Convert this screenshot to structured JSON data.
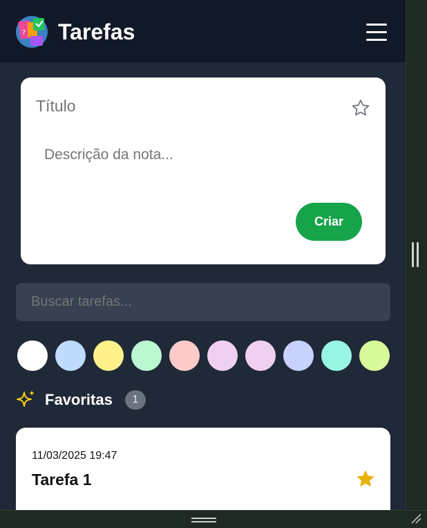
{
  "header": {
    "title": "Tarefas",
    "logo_icon": "sticky-notes-logo",
    "menu_icon": "hamburger-menu-icon"
  },
  "create_form": {
    "title_placeholder": "Título",
    "description_placeholder": "Descrição da nota...",
    "favorite_icon": "star-outline-icon",
    "create_label": "Criar"
  },
  "search": {
    "placeholder": "Buscar tarefas..."
  },
  "color_filters": [
    {
      "name": "white",
      "color": "#ffffff"
    },
    {
      "name": "blue",
      "color": "#bfdbfe"
    },
    {
      "name": "yellow",
      "color": "#fef08a"
    },
    {
      "name": "green",
      "color": "#bbf7d0"
    },
    {
      "name": "red",
      "color": "#fecaca"
    },
    {
      "name": "purple",
      "color": "#f0d0f2"
    },
    {
      "name": "pink",
      "color": "#f0d0f0"
    },
    {
      "name": "indigo",
      "color": "#c7d2fe"
    },
    {
      "name": "teal",
      "color": "#99f6e4"
    },
    {
      "name": "lime",
      "color": "#d9f99d"
    }
  ],
  "favorites": {
    "label": "Favoritas",
    "count": "1",
    "icon": "sparkles-icon"
  },
  "tasks": [
    {
      "date": "11/03/2025 19:47",
      "title": "Tarefa 1",
      "favorite": true
    }
  ],
  "colors": {
    "accent": "#16a34a",
    "star": "#eab308",
    "header_bg": "#111827",
    "page_bg": "#1f2937"
  }
}
